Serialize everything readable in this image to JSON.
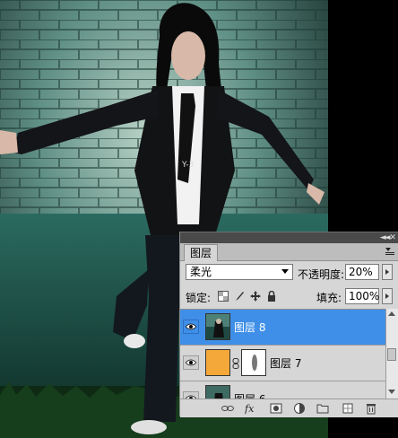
{
  "layers_panel": {
    "tab_label": "图层",
    "blend_mode": "柔光",
    "opacity_label": "不透明度:",
    "opacity_value": "20%",
    "lock_label": "锁定:",
    "fill_label": "填充:",
    "fill_value": "100%",
    "layers": [
      {
        "name": "图层 8",
        "selected": true,
        "has_mask": false
      },
      {
        "name": "图层 7",
        "selected": false,
        "has_mask": true,
        "thumb_color": "#f5a83a"
      },
      {
        "name": "图层 6",
        "selected": false,
        "has_mask": false
      }
    ],
    "bottom_icons": [
      "link-icon",
      "fx-icon",
      "add-mask-icon",
      "adjustment-layer-icon",
      "new-group-icon",
      "new-layer-icon",
      "delete-icon"
    ]
  },
  "photo": {
    "tie_print": "Y-3"
  },
  "colors": {
    "selection_blue": "#3f8fe8",
    "panel_bg": "#d6d6d6"
  }
}
